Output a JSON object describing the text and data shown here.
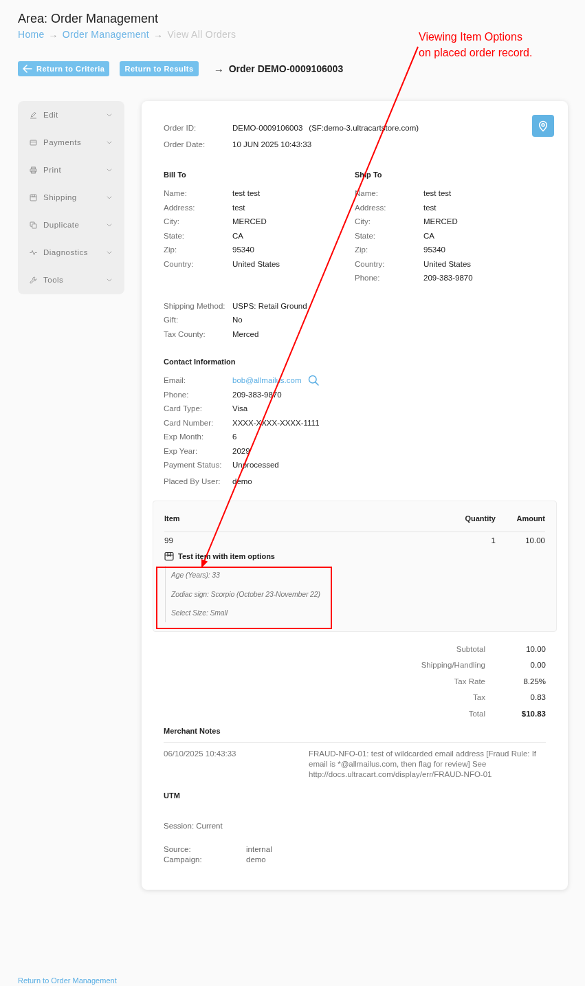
{
  "header": {
    "title": "Area: Order Management",
    "breadcrumb": [
      {
        "label": "Home",
        "current": false
      },
      {
        "separator": "→",
        "label": "Order Management",
        "current": false
      },
      {
        "separator": "→",
        "label": "View All Orders",
        "current": true
      }
    ]
  },
  "toolbar": {
    "buttons": [
      {
        "kind": "back",
        "label": "Return to Criteria"
      },
      {
        "kind": "plain",
        "label": "Return to Results"
      }
    ],
    "order_arrow": "→",
    "order_title": "Order DEMO-0009106003"
  },
  "sidebar": {
    "items": [
      {
        "label": "Edit",
        "expanded": false
      },
      {
        "label": "Payments",
        "expanded": false
      },
      {
        "label": "Print",
        "expanded": false
      },
      {
        "label": "Shipping",
        "expanded": false
      },
      {
        "label": "Duplicate",
        "expanded": false
      },
      {
        "label": "Diagnostics",
        "expanded": false
      },
      {
        "label": "Tools",
        "expanded": false
      }
    ]
  },
  "order": {
    "fields": [
      {
        "label": "Order ID:",
        "value": "DEMO-0009106003",
        "store": "(SF:demo-3.ultracartstore.com)"
      },
      {
        "label": "Order Date:",
        "value": "10 JUN 2025 10:43:33"
      }
    ]
  },
  "bill_to": {
    "heading": "Bill To",
    "fields": [
      {
        "label": "Name:",
        "value": "test test"
      },
      {
        "label": "Address:",
        "value": "test"
      },
      {
        "label": "City:",
        "value": "MERCED"
      },
      {
        "label": "State:",
        "value": "CA"
      },
      {
        "label": "Zip:",
        "value": "95340"
      },
      {
        "label": "Country:",
        "value": "United States"
      }
    ]
  },
  "ship_to": {
    "heading": "Ship To",
    "fields": [
      {
        "label": "Name:",
        "value": "test test"
      },
      {
        "label": "Address:",
        "value": "test"
      },
      {
        "label": "City:",
        "value": "MERCED"
      },
      {
        "label": "State:",
        "value": "CA"
      },
      {
        "label": "Zip:",
        "value": "95340"
      },
      {
        "label": "Country:",
        "value": "United States"
      },
      {
        "label": "Phone:",
        "value": "209-383-9870"
      }
    ]
  },
  "shipping": {
    "fields": [
      {
        "label": "Shipping Method:",
        "value": "USPS: Retail Ground"
      },
      {
        "label": "Gift:",
        "value": "No"
      },
      {
        "label": "Tax County:",
        "value": "Merced"
      }
    ]
  },
  "contact": {
    "heading": "Contact Information",
    "fields": [
      {
        "kind": "link",
        "label": "Email:",
        "value": "bob@allmailus.com"
      },
      {
        "kind": "text",
        "label": "Phone:",
        "value": "209-383-9870"
      },
      {
        "kind": "text",
        "label": "Card Type:",
        "value": "Visa"
      },
      {
        "kind": "text",
        "label": "Card Number:",
        "value": "XXXX-XXXX-XXXX-1111"
      },
      {
        "kind": "text",
        "label": "Exp Month:",
        "value": "6"
      },
      {
        "kind": "text",
        "label": "Exp Year:",
        "value": "2029"
      },
      {
        "kind": "text",
        "label": "Payment Status:",
        "value": "Unprocessed"
      },
      {
        "kind": "text",
        "label": "Placed By User:",
        "value": "demo"
      }
    ]
  },
  "items_table": {
    "columns": [
      "Item",
      "Quantity",
      "Amount"
    ],
    "rows": [
      {
        "sku": "99",
        "quantity": "1",
        "amount": "10.00",
        "description": "Test item with item options",
        "options": [
          "Age (Years): 33",
          "Zodiac sign: Scorpio (October 23-November 22)",
          "Select Size: Small"
        ]
      }
    ]
  },
  "totals": [
    {
      "label": "Subtotal",
      "value": "10.00",
      "emphasis": false
    },
    {
      "label": "Shipping/Handling",
      "value": "0.00",
      "emphasis": false
    },
    {
      "label": "Tax Rate",
      "value": "8.25%",
      "emphasis": false
    },
    {
      "label": "Tax",
      "value": "0.83",
      "emphasis": false
    },
    {
      "label": "Total",
      "value": "$10.83",
      "emphasis": true
    }
  ],
  "merchant_notes": {
    "heading": "Merchant Notes",
    "notes": [
      {
        "date": "06/10/2025 10:43:33",
        "text": "FRAUD-NFO-01: test of wildcarded email address [Fraud Rule: If email is *@allmailus.com, then flag for review] See http://docs.ultracart.com/display/err/FRAUD-NFO-01"
      }
    ]
  },
  "utm": {
    "heading": "UTM",
    "session": "Session: Current",
    "fields": [
      {
        "label": "Source:",
        "value": "internal"
      },
      {
        "label": "Campaign:",
        "value": "demo"
      }
    ]
  },
  "footer": {
    "link": "Return to Order Management"
  },
  "annotation": {
    "lines": [
      "Viewing Item Options",
      "on placed order record."
    ]
  }
}
